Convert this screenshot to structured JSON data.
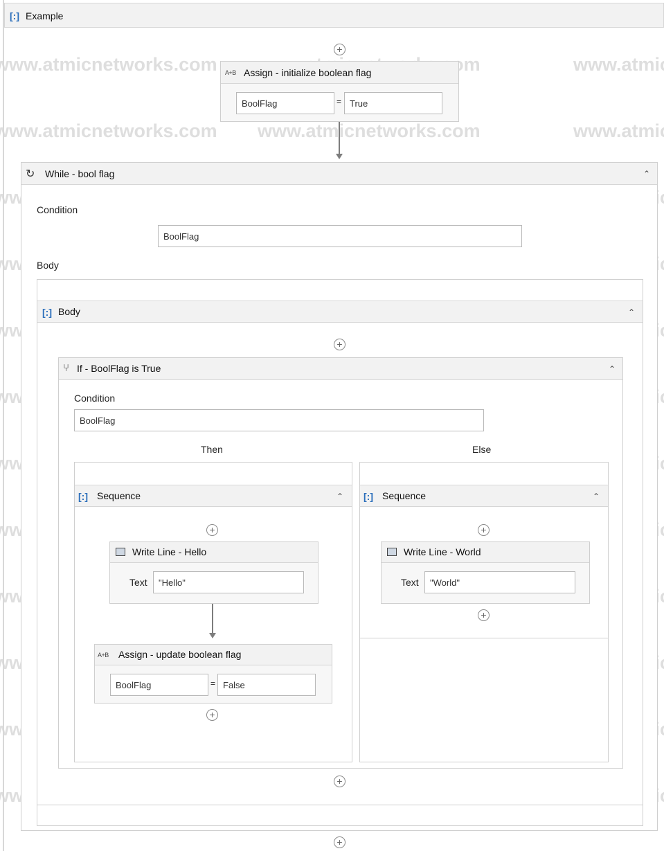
{
  "example": {
    "title": "Example"
  },
  "assign_init": {
    "title": "Assign - initialize boolean flag",
    "icon_label": "A+B",
    "to": "BoolFlag",
    "value": "True",
    "eq": "="
  },
  "while": {
    "title": "While - bool flag",
    "condition_label": "Condition",
    "condition": "BoolFlag",
    "body_label": "Body"
  },
  "body_seq": {
    "title": "Body"
  },
  "if": {
    "title": "If - BoolFlag is True",
    "condition_label": "Condition",
    "condition": "BoolFlag",
    "then_label": "Then",
    "else_label": "Else"
  },
  "then_seq": {
    "title": "Sequence",
    "write_line": {
      "title": "Write Line - Hello",
      "text_label": "Text",
      "text": "\"Hello\""
    },
    "assign": {
      "title": "Assign - update boolean flag",
      "icon_label": "A+B",
      "to": "BoolFlag",
      "value": "False",
      "eq": "="
    }
  },
  "else_seq": {
    "title": "Sequence",
    "write_line": {
      "title": "Write Line - World",
      "text_label": "Text",
      "text": "\"World\""
    }
  },
  "icons": {
    "add": "add-icon",
    "collapse": "collapse-chevron-icon",
    "sequence": "sequence-icon",
    "while": "while-loop-icon",
    "if": "if-icon",
    "write_line": "write-line-icon",
    "assign": "assign-icon"
  },
  "watermark": "www.atmicnetworks.com"
}
